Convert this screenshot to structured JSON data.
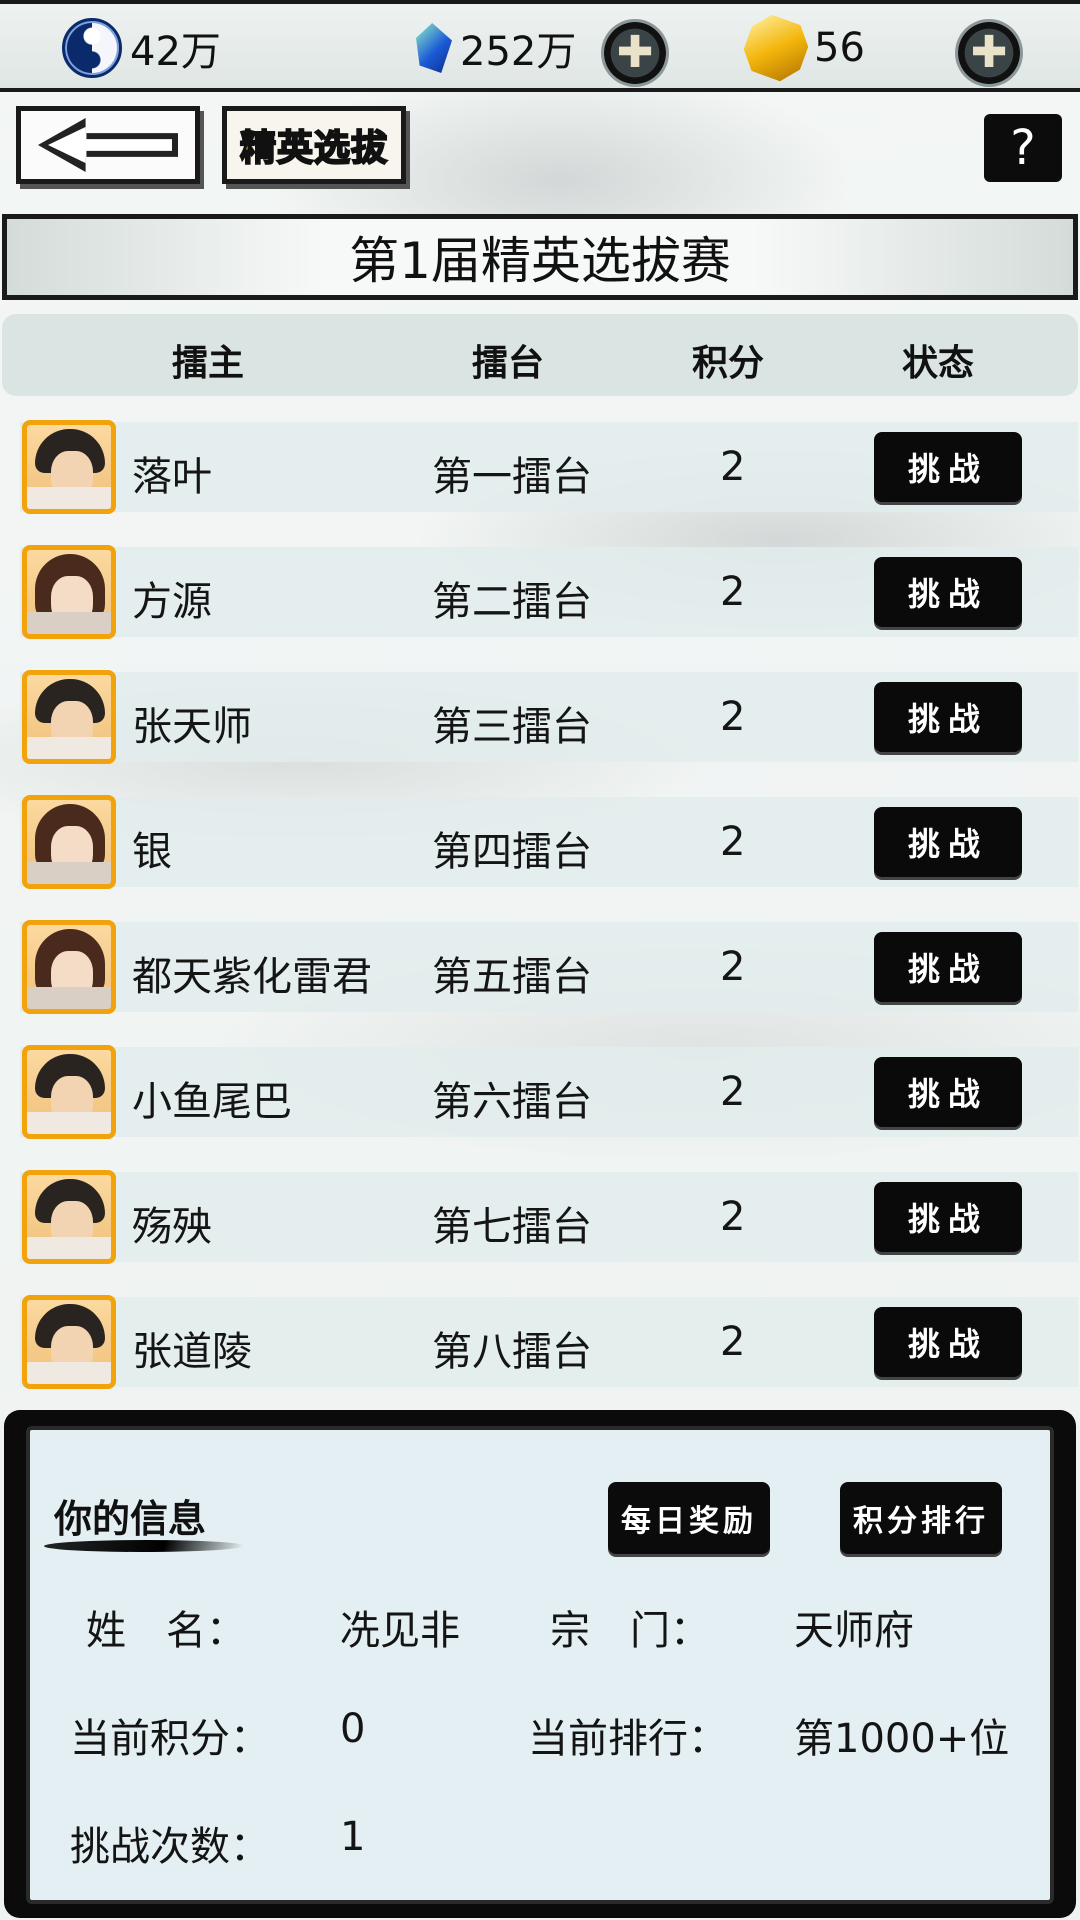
{
  "resources": {
    "coins": "42万",
    "crystals": "252万",
    "gold": "56"
  },
  "nav": {
    "tab_label": "精英选拔",
    "help_label": "?"
  },
  "title": "第1届精英选拔赛",
  "table": {
    "headers": [
      "擂主",
      "擂台",
      "积分",
      "状态"
    ],
    "rows": [
      {
        "name": "落叶",
        "arena": "第一擂台",
        "points": "2",
        "action": "挑战",
        "avatar": "male"
      },
      {
        "name": "方源",
        "arena": "第二擂台",
        "points": "2",
        "action": "挑战",
        "avatar": "female"
      },
      {
        "name": "张天师",
        "arena": "第三擂台",
        "points": "2",
        "action": "挑战",
        "avatar": "male"
      },
      {
        "name": "银",
        "arena": "第四擂台",
        "points": "2",
        "action": "挑战",
        "avatar": "female"
      },
      {
        "name": "都天紫化雷君",
        "arena": "第五擂台",
        "points": "2",
        "action": "挑战",
        "avatar": "female"
      },
      {
        "name": "小鱼尾巴",
        "arena": "第六擂台",
        "points": "2",
        "action": "挑战",
        "avatar": "male"
      },
      {
        "name": "殇殃",
        "arena": "第七擂台",
        "points": "2",
        "action": "挑战",
        "avatar": "male"
      },
      {
        "name": "张道陵",
        "arena": "第八擂台",
        "points": "2",
        "action": "挑战",
        "avatar": "male"
      }
    ]
  },
  "info": {
    "title": "你的信息",
    "daily_reward_label": "每日奖励",
    "ranking_label": "积分排行",
    "name_label": "姓　名：",
    "name_value": "冼见非",
    "sect_label": "宗　门：",
    "sect_value": "天师府",
    "points_label": "当前积分：",
    "points_value": "0",
    "rank_label": "当前排行：",
    "rank_value": "第1000+位",
    "challenges_label": "挑战次数：",
    "challenges_value": "1"
  },
  "colors": {
    "accent_gold": "#f2a20a",
    "button_black": "#0b0b0b",
    "tab_text_yellow": "#f6d40e"
  },
  "icons": [
    "yinyang-icon",
    "crystal-icon",
    "gold-gem-icon",
    "plus-icon",
    "back-arrow-icon"
  ]
}
